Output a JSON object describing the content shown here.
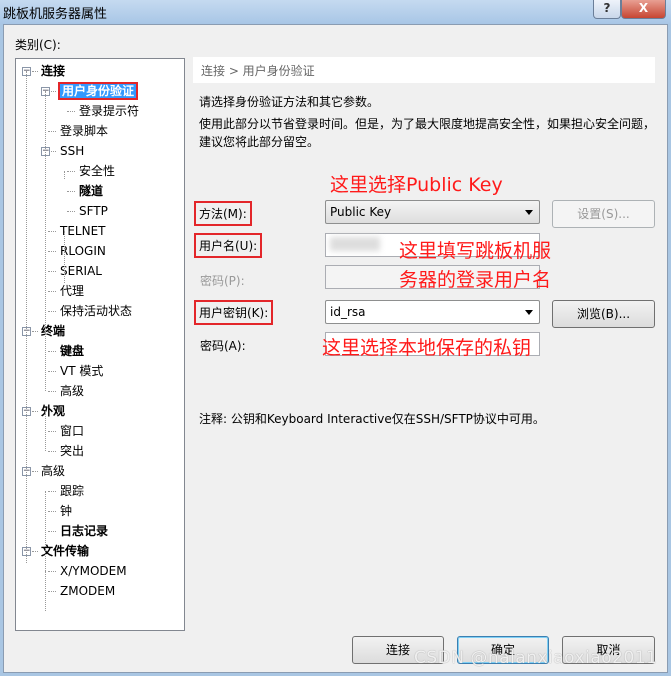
{
  "window": {
    "title": "跳板机服务器属性",
    "help": "?",
    "close": "X"
  },
  "category_label": "类别(C):",
  "tree": [
    {
      "label": "连接",
      "level": 0,
      "bold": true,
      "expander": true
    },
    {
      "label": "用户身份验证",
      "level": 1,
      "bold": true,
      "expander": true,
      "selected": true
    },
    {
      "label": "登录提示符",
      "level": 2
    },
    {
      "label": "登录脚本",
      "level": 1
    },
    {
      "label": "SSH",
      "level": 1,
      "expander": true
    },
    {
      "label": "安全性",
      "level": 2
    },
    {
      "label": "隧道",
      "level": 2,
      "bold": true
    },
    {
      "label": "SFTP",
      "level": 2
    },
    {
      "label": "TELNET",
      "level": 1
    },
    {
      "label": "RLOGIN",
      "level": 1
    },
    {
      "label": "SERIAL",
      "level": 1
    },
    {
      "label": "代理",
      "level": 1
    },
    {
      "label": "保持活动状态",
      "level": 1
    },
    {
      "label": "终端",
      "level": 0,
      "bold": true,
      "expander": true
    },
    {
      "label": "键盘",
      "level": 1,
      "bold": true
    },
    {
      "label": "VT 模式",
      "level": 1
    },
    {
      "label": "高级",
      "level": 1
    },
    {
      "label": "外观",
      "level": 0,
      "bold": true,
      "expander": true
    },
    {
      "label": "窗口",
      "level": 1
    },
    {
      "label": "突出",
      "level": 1
    },
    {
      "label": "高级",
      "level": 0,
      "expander": true
    },
    {
      "label": "跟踪",
      "level": 1
    },
    {
      "label": "钟",
      "level": 1
    },
    {
      "label": "日志记录",
      "level": 1,
      "bold": true
    },
    {
      "label": "文件传输",
      "level": 0,
      "bold": true,
      "expander": true
    },
    {
      "label": "X/YMODEM",
      "level": 1
    },
    {
      "label": "ZMODEM",
      "level": 1
    }
  ],
  "panel": {
    "breadcrumb": "连接 > 用户身份验证",
    "intro": "请选择身份验证方法和其它参数。",
    "note1": "使用此部分以节省登录时间。但是，为了最大限度地提高安全性，如果担心安全问题，",
    "note2": "建议您将此部分留空。",
    "method_label": "方法(M):",
    "method_value": "Public Key",
    "settings_button": "设置(S)...",
    "username_label": "用户名(U):",
    "username_value": "",
    "password_label": "密码(P):",
    "userkey_label": "用户密钥(K):",
    "userkey_value": "id_rsa",
    "browse_button": "浏览(B)...",
    "passphrase_label": "密码(A):",
    "footnote": "注释: 公钥和Keyboard Interactive仅在SSH/SFTP协议中可用。"
  },
  "annotations": {
    "a1": "这里选择Public Key",
    "a2": "这里填写跳板机服",
    "a3": "务器的登录用户名",
    "a4": "这里选择本地保存的私钥"
  },
  "buttons": {
    "connect": "连接",
    "ok": "确定",
    "cancel": "取消"
  },
  "watermark": "CSDN @nalanxiaoxiao2011",
  "colors": {
    "annotation": "#ff1a1a",
    "selection": "#3399ff"
  }
}
